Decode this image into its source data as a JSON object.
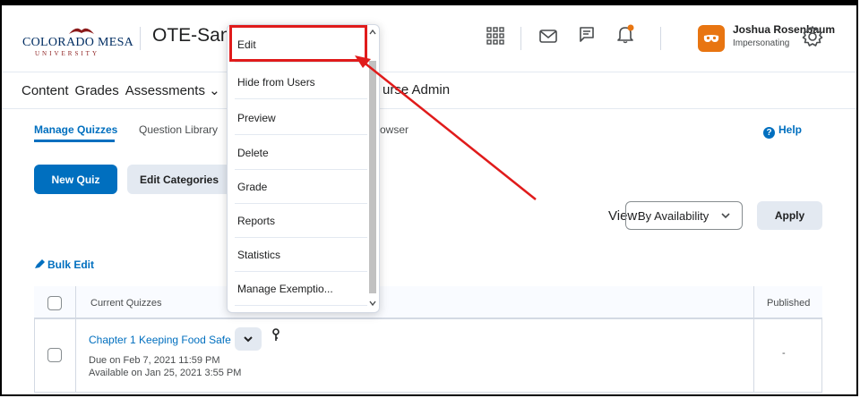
{
  "header": {
    "logo_word": "COLORADO MESA",
    "logo_sub": "UNIVERSITY",
    "course_title": "OTE-Sandb",
    "user_name": "Joshua Rosenbaum",
    "user_role": "Impersonating",
    "icons": [
      "grid-icon",
      "mail-icon",
      "chat-icon",
      "bell-icon",
      "gear-icon"
    ]
  },
  "nav": {
    "items": [
      "Content",
      "Grades",
      "Assessments ⌄",
      "urse Admin"
    ]
  },
  "tabs": {
    "manage_quizzes": "Manage Quizzes",
    "question_library": "Question Library",
    "browser_partial": "owser",
    "help": "Help"
  },
  "toolbar": {
    "new_quiz": "New Quiz",
    "edit_categories": "Edit Categories",
    "view_label": "View:",
    "view_value": "By Availability",
    "apply": "Apply",
    "bulk_edit": "Bulk Edit"
  },
  "table": {
    "col_current_quizzes": "Current Quizzes",
    "col_published": "Published",
    "rows": [
      {
        "title": "Chapter 1 Keeping Food Safe",
        "due": "Due on Feb 7, 2021 11:59 PM",
        "available": "Available on Jan 25, 2021 3:55 PM",
        "published": "-"
      }
    ]
  },
  "context_menu": {
    "items": [
      "Edit",
      "Hide from Users",
      "Preview",
      "Delete",
      "Grade",
      "Reports",
      "Statistics",
      "Manage Exemptio..."
    ]
  },
  "colors": {
    "brand_blue": "#006fbf",
    "avatar_orange": "#e87511",
    "annotation_red": "#e01b1b"
  }
}
